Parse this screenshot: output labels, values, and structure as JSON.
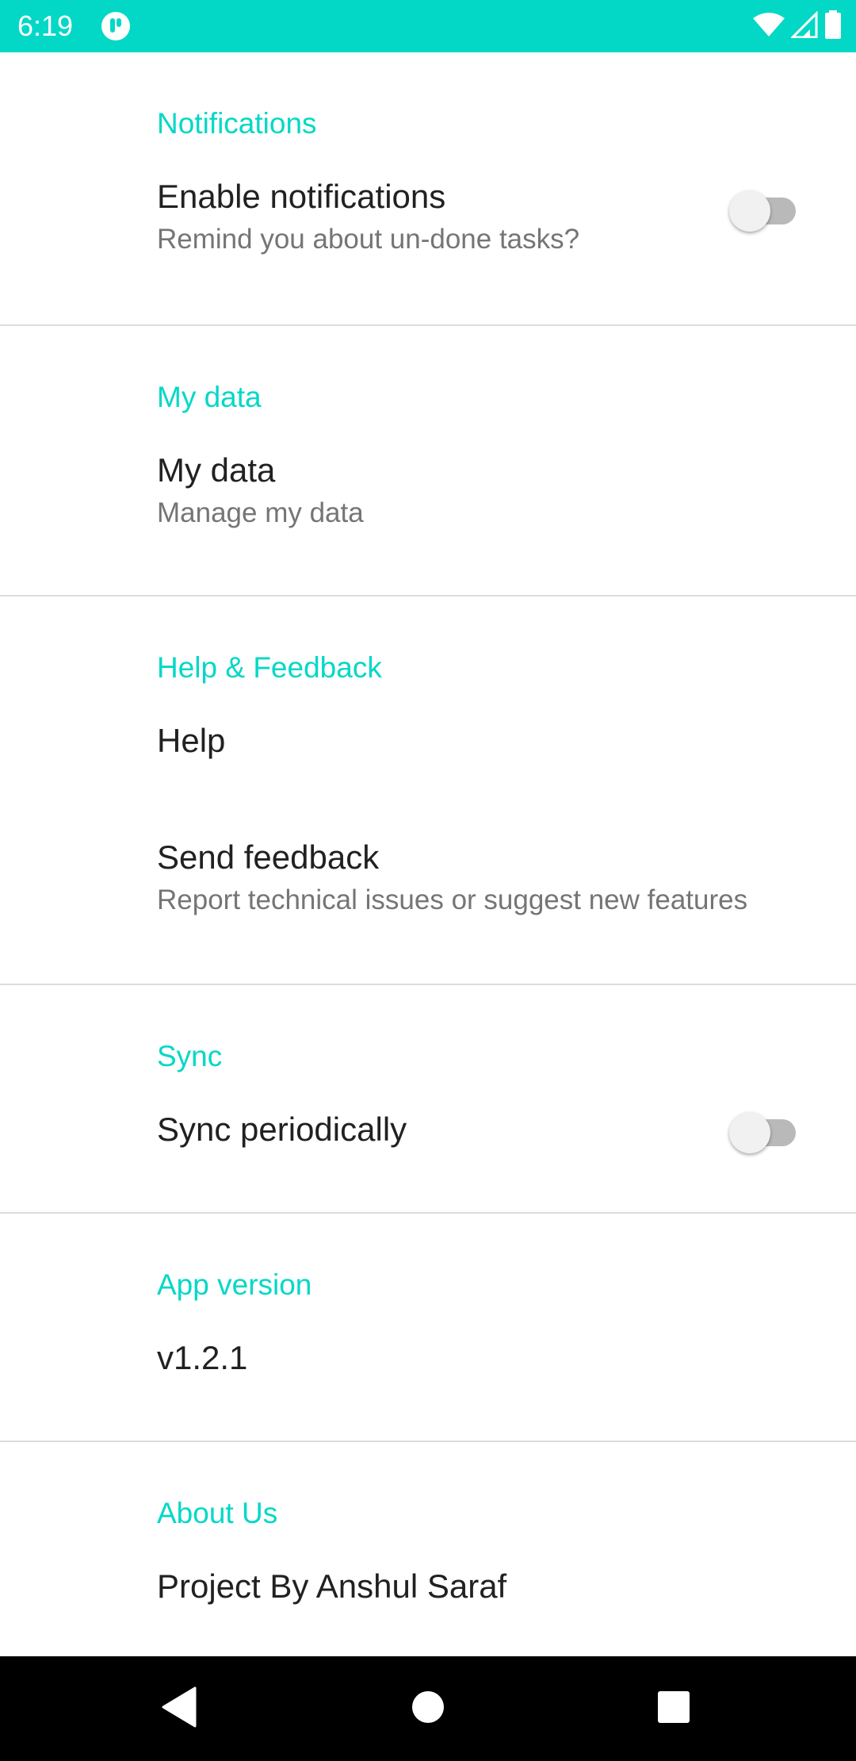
{
  "status_bar": {
    "time": "6:19",
    "background_color": "#03d8c6",
    "icons": [
      "app-notification-icon",
      "wifi-icon",
      "cellular-signal-icon",
      "battery-icon"
    ]
  },
  "accent_color": "#03d8c6",
  "sections": [
    {
      "header": "Notifications",
      "items": [
        {
          "title": "Enable notifications",
          "summary": "Remind you about un-done tasks?",
          "toggle": false
        }
      ]
    },
    {
      "header": "My data",
      "items": [
        {
          "title": "My data",
          "summary": "Manage my data"
        }
      ]
    },
    {
      "header": "Help & Feedback",
      "items": [
        {
          "title": "Help"
        },
        {
          "title": "Send feedback",
          "summary": "Report technical issues or suggest new features"
        }
      ]
    },
    {
      "header": "Sync",
      "items": [
        {
          "title": "Sync periodically",
          "toggle": false
        }
      ]
    },
    {
      "header": "App version",
      "items": [
        {
          "title": "v1.2.1"
        }
      ]
    },
    {
      "header": "About Us",
      "items": [
        {
          "title": "Project By Anshul Saraf"
        }
      ]
    }
  ],
  "nav_bar": {
    "buttons": [
      "back-icon",
      "home-icon",
      "recents-icon"
    ]
  }
}
